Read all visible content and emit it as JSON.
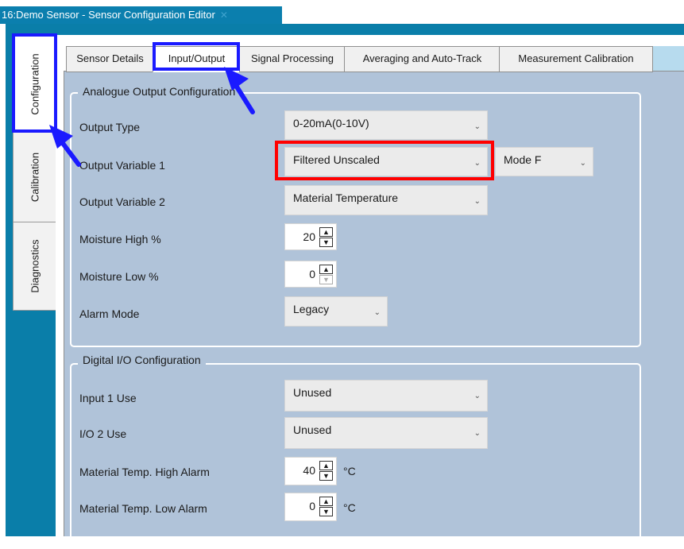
{
  "window": {
    "title": "16:Demo Sensor - Sensor Configuration Editor",
    "close_glyph": "✕"
  },
  "side_tabs": [
    "Configuration",
    "Calibration",
    "Diagnostics"
  ],
  "top_tabs": [
    "Sensor Details",
    "Input/Output",
    "Signal Processing",
    "Averaging and Auto-Track",
    "Measurement Calibration"
  ],
  "analogue": {
    "title": "Analogue Output Configuration",
    "output_type": {
      "label": "Output Type",
      "value": "0-20mA(0-10V)"
    },
    "output_var1": {
      "label": "Output Variable 1",
      "value": "Filtered Unscaled",
      "mode": "Mode F"
    },
    "output_var2": {
      "label": "Output Variable 2",
      "value": "Material Temperature"
    },
    "moisture_high": {
      "label": "Moisture High %",
      "value": "20"
    },
    "moisture_low": {
      "label": "Moisture Low %",
      "value": "0"
    },
    "alarm_mode": {
      "label": "Alarm Mode",
      "value": "Legacy"
    }
  },
  "digital": {
    "title": "Digital I/O Configuration",
    "input1": {
      "label": "Input 1 Use",
      "value": "Unused"
    },
    "io2": {
      "label": "I/O 2 Use",
      "value": "Unused"
    },
    "temp_high": {
      "label": "Material Temp. High Alarm",
      "value": "40",
      "unit": "°C"
    },
    "temp_low": {
      "label": "Material Temp. Low Alarm",
      "value": "0",
      "unit": "°C"
    }
  },
  "icons": {
    "dropdown": "chevron-down-icon",
    "spin_up": "triangle-up-icon",
    "spin_down": "triangle-down-icon"
  },
  "colors": {
    "workspace": "#0a7ea9",
    "panel": "#b0c3d9",
    "highlight_blue": "#1a1aff",
    "highlight_red": "#ff0000"
  }
}
